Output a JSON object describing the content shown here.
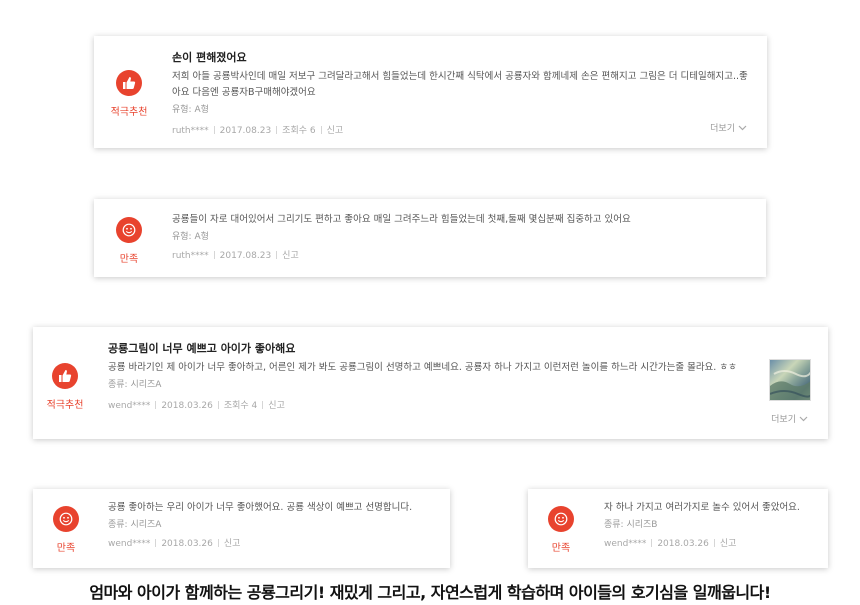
{
  "reviews": [
    {
      "badge": "적극추천",
      "badge_icon": "thumbs-up-icon",
      "title": "손이 편해졌어요",
      "body": "저희 아들 공룡박사인데 매일 저보구 그려달라고해서 힘들었는데 한시간째 식탁에서 공룡자와 함께네제 손은 편해지고 그림은 더 디테일해지고..좋아요 다음엔 공룡자B구매해야겠어요",
      "type": "유형: A형",
      "author": "ruth****",
      "date": "2017.08.23",
      "views": "조회수 6",
      "report": "신고",
      "more": "더보기"
    },
    {
      "badge": "만족",
      "badge_icon": "smile-icon",
      "body": "공룡들이 자로 대어있어서 그리기도 편하고 좋아요 매일 그려주느라 힘들었는데 첫째,둘째 몇십분째 집중하고 있어요",
      "type": "유형: A형",
      "author": "ruth****",
      "date": "2017.08.23",
      "report": "신고"
    },
    {
      "badge": "적극추천",
      "badge_icon": "thumbs-up-icon",
      "title": "공룡그림이 너무 예쁘고 아이가 좋아해요",
      "body": "공룡 바라기인 제 아이가 너무 좋아하고, 어른인 제가 봐도 공룡그림이 선명하고 예쁘네요. 공룡자 하나 가지고 이런저런 놀이를 하느라 시간가는줄 몰라요. ㅎㅎ",
      "type": "종류: 시리즈A",
      "author": "wend****",
      "date": "2018.03.26",
      "views": "조회수 4",
      "report": "신고",
      "more": "더보기"
    },
    {
      "badge": "만족",
      "badge_icon": "smile-icon",
      "body": "공룡 좋아하는 우리 아이가 너무 좋아했어요. 공룡 색상이 예쁘고 선명합니다.",
      "type": "종류: 시리즈A",
      "author": "wend****",
      "date": "2018.03.26",
      "report": "신고"
    },
    {
      "badge": "만족",
      "badge_icon": "smile-icon",
      "body": "자 하나 가지고 여러가지로 놀수 있어서 좋았어요.",
      "type": "종류: 시리즈B",
      "author": "wend****",
      "date": "2018.03.26",
      "report": "신고"
    }
  ],
  "footer": "엄마와 아이가 함께하는 공룡그리기! 재밌게 그리고, 자연스럽게 학습하며 아이들의 호기심을 일깨웁니다!",
  "colors": {
    "accent": "#e8432e"
  }
}
